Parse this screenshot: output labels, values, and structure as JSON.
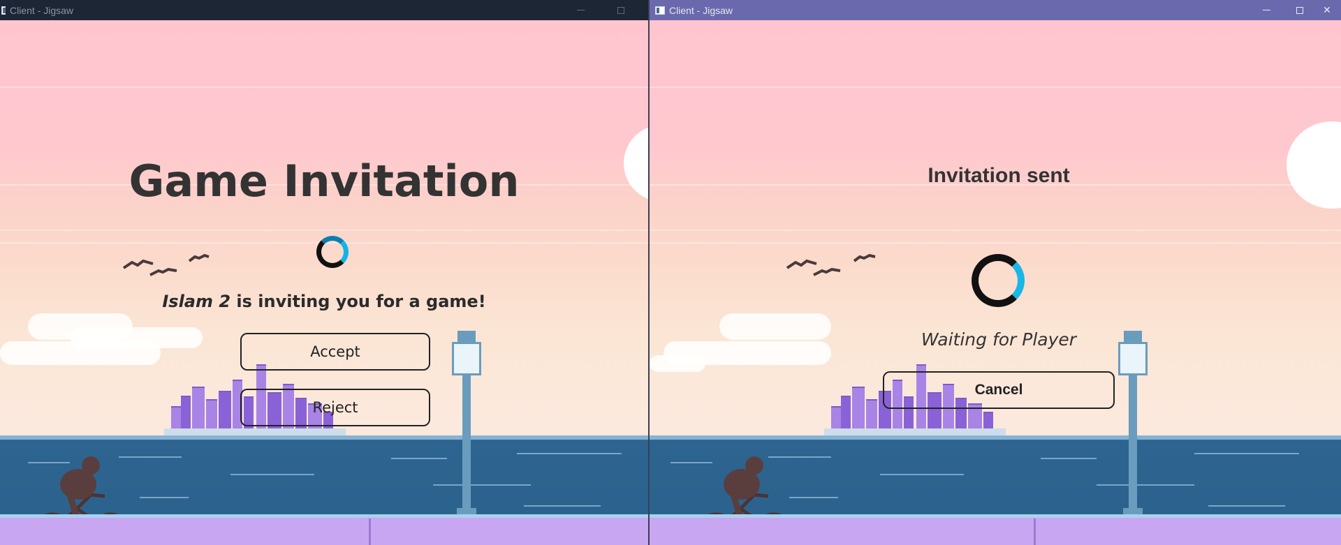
{
  "left_window": {
    "title": "Client - Jigsaw",
    "heading": "Game Invitation",
    "inviter": "Islam 2",
    "invite_text": " is inviting you for a game!",
    "accept_label": "Accept",
    "reject_label": "Reject"
  },
  "right_window": {
    "title": "Client - Jigsaw",
    "heading": "Invitation sent",
    "waiting_text": "Waiting for Player",
    "cancel_label": "Cancel",
    "controls": {
      "minimize": "—",
      "maximize": "☐",
      "close": "✕"
    }
  },
  "colors": {
    "right_titlebar": "#6b69ad",
    "left_titlebar": "#1c2634",
    "sky_pink": "#ffc5cf",
    "sea": "#2b628d",
    "spinner_accent": "#0fb6e8"
  },
  "icons": [
    "app-window-icon",
    "minimize-icon",
    "maximize-icon",
    "close-icon",
    "loading-spinner-icon"
  ]
}
